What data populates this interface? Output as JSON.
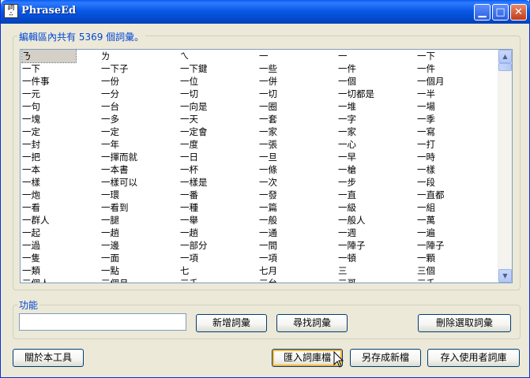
{
  "window": {
    "title": "PhraseEd"
  },
  "icons": {
    "app": "phraseed-app-icon",
    "minimize": "minimize-icon",
    "maximize": "maximize-icon",
    "close": "close-icon",
    "cursor": "mouse-pointer-icon"
  },
  "editor": {
    "group_label": "編輯區內共有 5369 個詞彙。",
    "rows": [
      [
        "ㄋ",
        "ㄌ",
        "ㄟ",
        "一",
        "一",
        "一下"
      ],
      [
        "一下",
        "一下子",
        "一下鍵",
        "一些",
        "一件",
        "一件"
      ],
      [
        "一件事",
        "一份",
        "一位",
        "一併",
        "一個",
        "一個月"
      ],
      [
        "一元",
        "一分",
        "一切",
        "一切",
        "一切都是",
        "一半"
      ],
      [
        "一句",
        "一台",
        "一向是",
        "一圈",
        "一堆",
        "一場"
      ],
      [
        "一塊",
        "一多",
        "一天",
        "一套",
        "一字",
        "一季"
      ],
      [
        "一定",
        "一定",
        "一定會",
        "一家",
        "一家",
        "一寫"
      ],
      [
        "一封",
        "一年",
        "一度",
        "一張",
        "一心",
        "一打"
      ],
      [
        "一把",
        "一揮而就",
        "一日",
        "一旦",
        "一早",
        "一時"
      ],
      [
        "一本",
        "一本書",
        "一杯",
        "一條",
        "一槍",
        "一樣"
      ],
      [
        "一樣",
        "一樣可以",
        "一樣是",
        "一次",
        "一步",
        "一段"
      ],
      [
        "一炮",
        "一環",
        "一番",
        "一發",
        "一直",
        "一直都"
      ],
      [
        "一看",
        "一看到",
        "一種",
        "一篇",
        "一級",
        "一組"
      ],
      [
        "一群人",
        "一腿",
        "一舉",
        "一般",
        "一般人",
        "一萬"
      ],
      [
        "一起",
        "一趟",
        "一趟",
        "一通",
        "一週",
        "一遍"
      ],
      [
        "一過",
        "一邊",
        "一部分",
        "一間",
        "一陣子",
        "一陣子"
      ],
      [
        "一隻",
        "一面",
        "一項",
        "一項",
        "一頓",
        "一顆"
      ],
      [
        "一類",
        "一點",
        "七",
        "七月",
        "三",
        "三個"
      ],
      [
        "三個人",
        "三個月",
        "三千",
        "三台",
        "三哥",
        "三千"
      ]
    ]
  },
  "functions": {
    "group_label": "功能",
    "input_value": "",
    "add_label": "新增詞彙",
    "find_label": "尋找詞彙",
    "delete_label": "刪除選取詞彙"
  },
  "bottom": {
    "about_label": "關於本工具",
    "import_label": "匯入詞庫檔",
    "save_new_label": "另存成新檔",
    "save_user_label": "存入使用者詞庫"
  }
}
